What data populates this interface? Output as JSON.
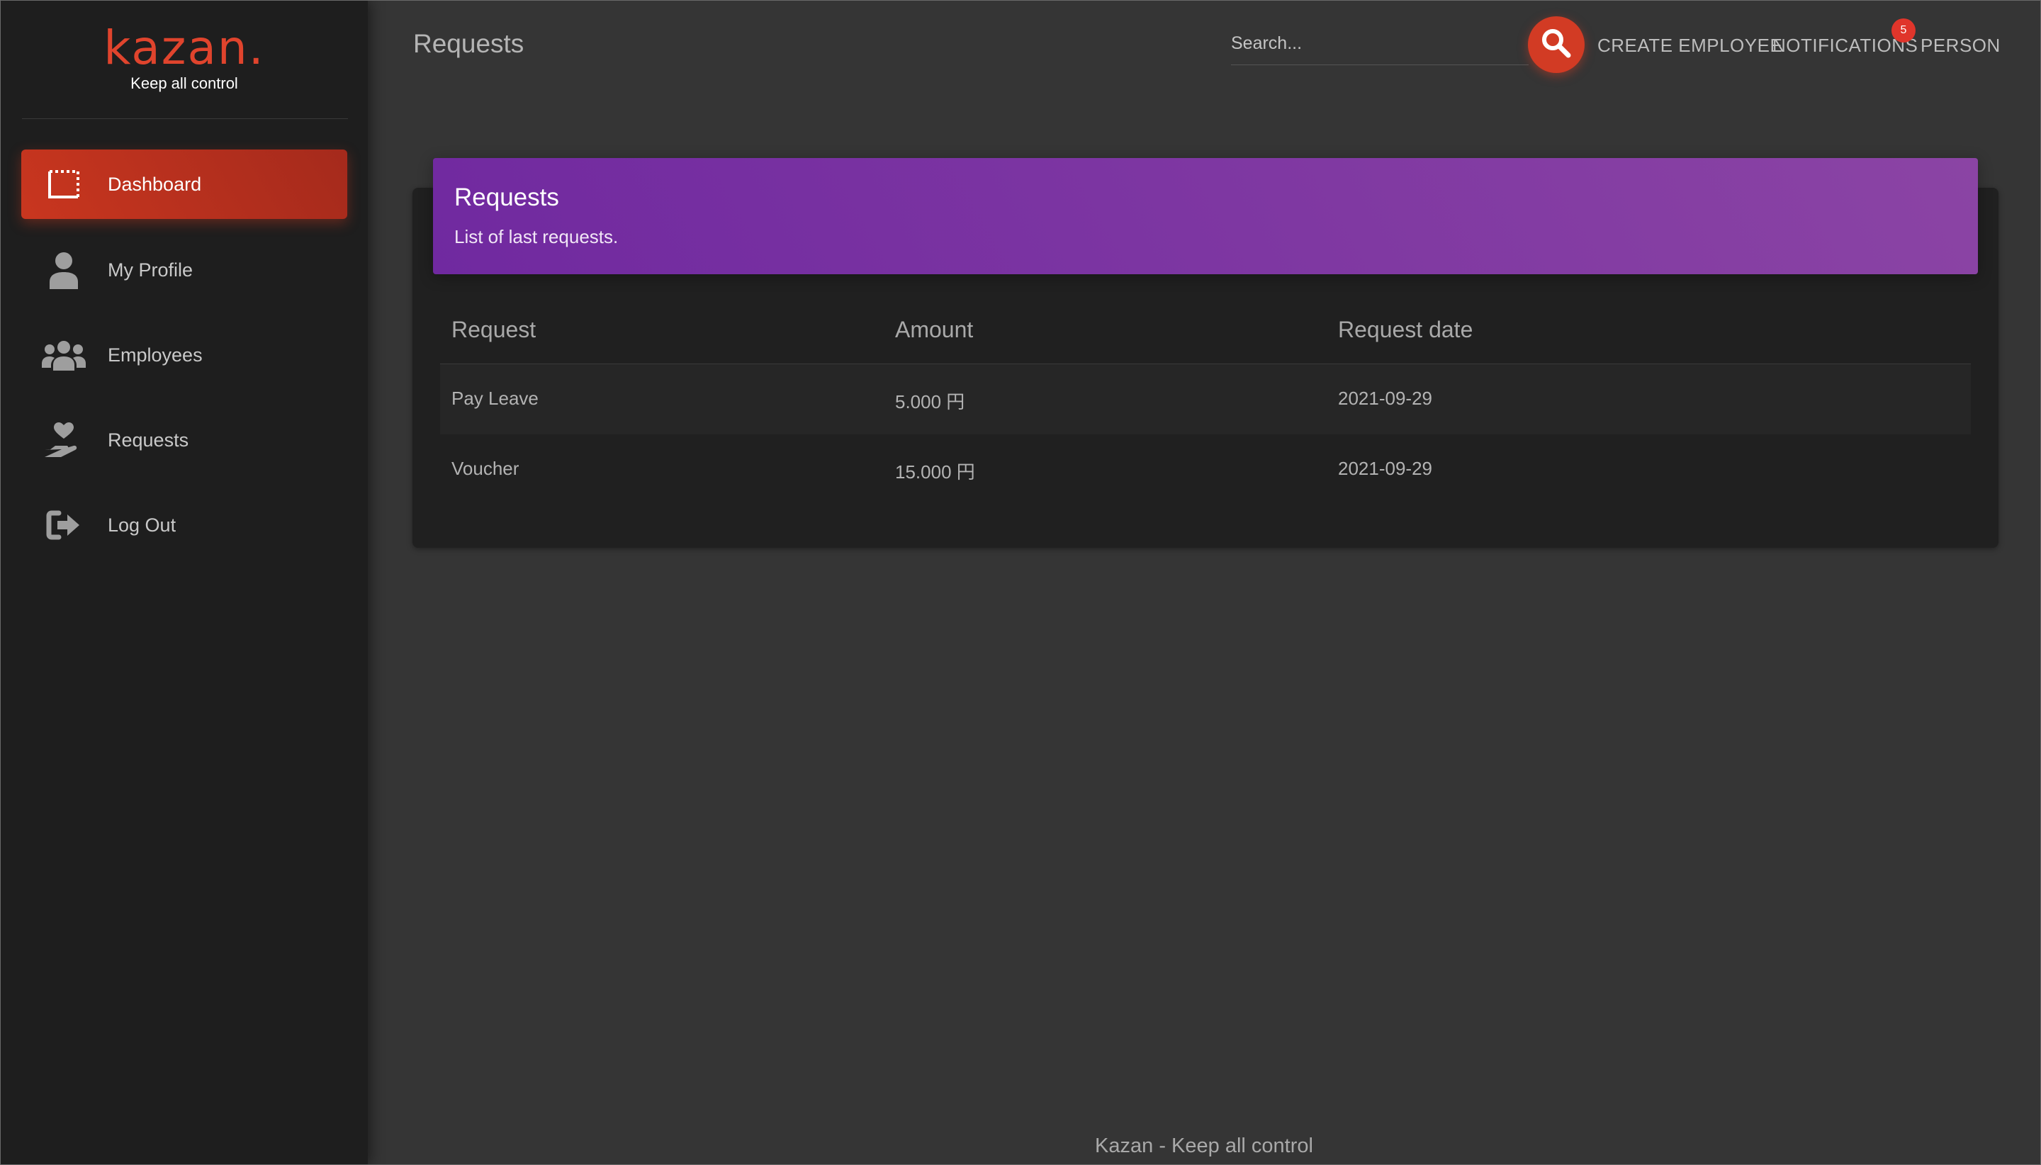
{
  "brand": {
    "name": "kazan.",
    "tagline": "Keep all control"
  },
  "sidebar": {
    "items": [
      {
        "label": "Dashboard",
        "icon": "dashboard-icon",
        "active": true
      },
      {
        "label": "My Profile",
        "icon": "user-icon",
        "active": false
      },
      {
        "label": "Employees",
        "icon": "users-icon",
        "active": false
      },
      {
        "label": "Requests",
        "icon": "hand-heart-icon",
        "active": false
      },
      {
        "label": "Log Out",
        "icon": "sign-out-icon",
        "active": false
      }
    ]
  },
  "header": {
    "title": "Requests",
    "search_placeholder": "Search...",
    "create_employee": "CREATE EMPLOYEE",
    "notifications": "NOTIFICATIONS",
    "notifications_count": "5",
    "person": "PERSON"
  },
  "card": {
    "title": "Requests",
    "subtitle": "List of last requests.",
    "columns": [
      "Request",
      "Amount",
      "Request date"
    ],
    "rows": [
      {
        "request": "Pay Leave",
        "amount": "5.000 円",
        "date": "2021-09-29"
      },
      {
        "request": "Voucher",
        "amount": "15.000 円",
        "date": "2021-09-29"
      }
    ]
  },
  "footer": {
    "text": "Kazan - Keep all control"
  },
  "colors": {
    "accent": "#c9361f",
    "card_header": "#7b30a4",
    "sidebar_bg": "#1e1e1e",
    "main_bg": "#353535"
  }
}
